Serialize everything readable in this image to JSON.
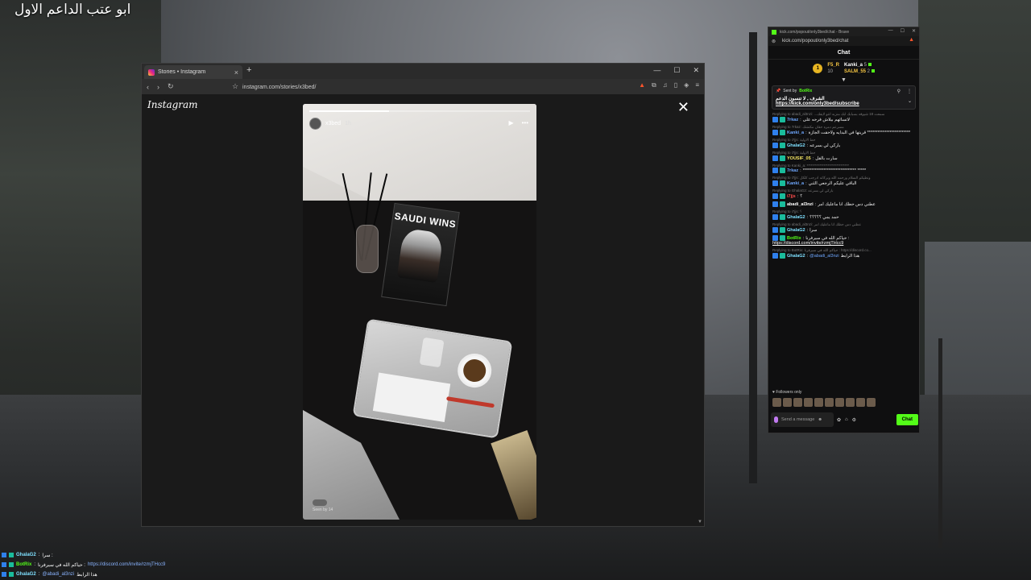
{
  "overlay": {
    "title": "ابو عتب الداعم الاول"
  },
  "browser": {
    "tab_title": "Stories • Instagram",
    "tab_close": "×",
    "new_tab": "+",
    "win_controls": [
      "—",
      "☐",
      "✕"
    ],
    "url": "instagram.com/stories/x3bed/",
    "nav": {
      "back": "‹",
      "forward": "›",
      "reload": "↻",
      "bookmark": "⌂"
    }
  },
  "instagram": {
    "logo": "Instagram",
    "close": "✕",
    "story": {
      "username": "x3bed",
      "time": "1h",
      "progress": 0.36,
      "book_title": "SAUDI WINS",
      "seen_by": "Seen by 14"
    }
  },
  "chat": {
    "window_title": "kick.com/popout/only3bed/chat - Brave",
    "url": "kick.com/popout/only3bed/chat",
    "header": "Chat",
    "leaderboard": {
      "col1": [
        {
          "name": "F5_R",
          "count": ""
        },
        {
          "name": "",
          "count": "10"
        }
      ],
      "col2": [
        {
          "name": "Kanki_a",
          "count": "5"
        },
        {
          "name": "SALM_55",
          "count": "2"
        }
      ],
      "badge": "1"
    },
    "pinned": {
      "sent_by": "Sent by",
      "bot": "BotRix",
      "text": "الشرف , لا تنسون الدعم",
      "link": "https://kick.com/only3bed/subscribe"
    },
    "messages": [
      {
        "reply": "Replying to abadi_al3nzi: ...سمعت 18 شيوقه بسبابك ابك منزبه انتو لايفك",
        "user": "7rkaz",
        "color": "u-blue",
        "text": "لاتسائهم بيلاش فرحه على"
      },
      {
        "reply": "Replying to 7rkaz: مسرعم دمره حقان مكتشك",
        "user": "Kanki_a",
        "color": "u-blue",
        "text": "قريتها في البدايه ولاحقت الجازة *************************"
      },
      {
        "reply": "Replying to i7jjs: حط الاولية",
        "user": "GhalaG2",
        "color": "u-cyan",
        "text": "باركي لي بسرعه"
      },
      {
        "reply": "Replying to i7jjs: حط الاولية",
        "user": "YOUSIF_05",
        "color": "u-yellow",
        "text": "سارت بالقل"
      },
      {
        "reply": "Replying to Kanki_a: ******************************",
        "user": "7rkaz",
        "color": "u-blue",
        "text": "******************************* *****"
      },
      {
        "reply": "Replying to i7jjs: ونطيكم السلام ورحمه الله وبركاته ادرجب كلكل",
        "user": "Kanki_a",
        "color": "u-blue",
        "text": "الباقي عليكم الرجعي الثني"
      },
      {
        "reply": "Replying to GhalaG2: باركي لي بسرعه",
        "user": "i7jjs",
        "color": "u-red",
        "text": "؟"
      },
      {
        "reply": "",
        "user": "abadi_al3nzi",
        "color": "u-white",
        "text": "عطني دس حظك انا ماعليك امر"
      },
      {
        "reply": "Replying to i7jjs: ؟",
        "user": "GhalaG2",
        "color": "u-cyan",
        "text": "حمد يمي ؟؟؟؟؟"
      },
      {
        "reply": "Replying to abadi_al3nzi: عطني دس حظك انا ماعليك امر",
        "user": "GhalaG2",
        "color": "u-cyan",
        "text": "سرا"
      },
      {
        "reply": "",
        "user": "BotRix",
        "color": "u-green",
        "text": "حياكم الله في سيرفرنا :",
        "link": "https://discord.com/invite/rzmjTHcc9"
      },
      {
        "reply": "Replying to BotRix: حياكم الله في سيرفرنا : https://discord.co...",
        "user": "GhalaG2",
        "color": "u-cyan",
        "text": "هذا الرابط",
        "mention": "@abadi_al3nzi"
      }
    ],
    "followers_only": "Followers only",
    "input_placeholder": "Send a message",
    "send_label": "Chat"
  },
  "stream_overlay_chat": [
    {
      "user": "GhalaG2",
      "text": "سرا :"
    },
    {
      "user": "BotRix",
      "text": "حياكم الله في سيرفرنا :",
      "link": "https://discord.com/invite/rzmjTHcc9"
    },
    {
      "user": "GhalaG2",
      "mention": "@abadi_al3nzi",
      "text": "هذا الرابط"
    }
  ]
}
